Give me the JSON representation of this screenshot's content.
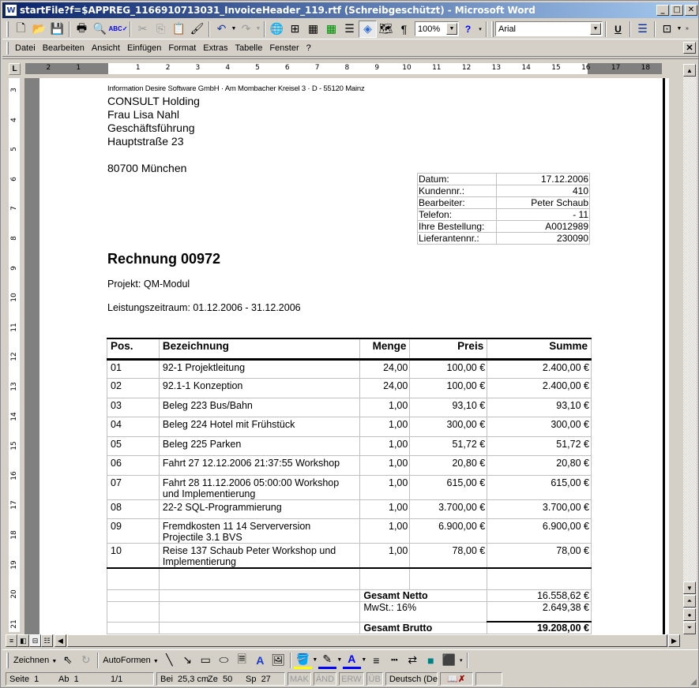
{
  "window": {
    "title": "startFile?f=$APPREG_1166910713031_InvoiceHeader_119.rtf (Schreibgeschützt) - Microsoft Word",
    "app_icon": "word-icon",
    "controls": [
      "minimize",
      "maximize",
      "close"
    ]
  },
  "standard_toolbar": {
    "zoom": "100%",
    "font": "Arial",
    "buttons": [
      "new-document",
      "open",
      "save",
      "print",
      "print-preview",
      "spelling",
      "cut",
      "copy",
      "paste",
      "format-painter",
      "undo",
      "redo",
      "hyperlink",
      "tables-borders",
      "insert-table",
      "insert-excel",
      "columns",
      "drawing",
      "document-map",
      "show-formatting",
      "help",
      "underline",
      "bullets",
      "borders"
    ]
  },
  "menu": {
    "items": [
      {
        "label": "Datei",
        "accel": "D"
      },
      {
        "label": "Bearbeiten",
        "accel": "B"
      },
      {
        "label": "Ansicht",
        "accel": "A"
      },
      {
        "label": "Einfügen",
        "accel": "E"
      },
      {
        "label": "Format",
        "accel": "t"
      },
      {
        "label": "Extras",
        "accel": "x"
      },
      {
        "label": "Tabelle",
        "accel": "l"
      },
      {
        "label": "Fenster",
        "accel": "F"
      },
      {
        "label": "?",
        "accel": "?"
      }
    ]
  },
  "ruler": {
    "horizontal_labels": [
      "2",
      "1",
      "1",
      "2",
      "3",
      "4",
      "5",
      "6",
      "7",
      "8",
      "9",
      "10",
      "11",
      "12",
      "13",
      "14",
      "15",
      "16",
      "17",
      "18"
    ],
    "vertical_labels": [
      "3",
      "4",
      "5",
      "6",
      "7",
      "8",
      "9",
      "10",
      "11",
      "12",
      "13",
      "14",
      "15",
      "16",
      "17",
      "18",
      "19",
      "20",
      "21"
    ]
  },
  "document": {
    "sender_line": "Information Desire Software GmbH · Am Mombacher Kreisel 3 · D - 55120 Mainz",
    "recipient": [
      "CONSULT Holding",
      "Frau Lisa Nahl",
      "Geschäftsführung",
      "Hauptstraße 23"
    ],
    "city": "80700 München",
    "info": [
      {
        "label": "Datum:",
        "value": "17.12.2006"
      },
      {
        "label": "Kundennr.:",
        "value": "410"
      },
      {
        "label": "Bearbeiter:",
        "value": "Peter Schaub"
      },
      {
        "label": "Telefon:",
        "value": "- 11"
      },
      {
        "label": "Ihre Bestellung:",
        "value": "A0012989"
      },
      {
        "label": "Lieferantennr.:",
        "value": "230090"
      }
    ],
    "heading": "Rechnung 00972",
    "project": "Projekt: QM-Modul",
    "period": "Leistungszeitraum: 01.12.2006 - 31.12.2006",
    "table": {
      "headers": [
        "Pos.",
        "Bezeichnung",
        "Menge",
        "Preis",
        "Summe"
      ],
      "rows": [
        {
          "pos": "01",
          "desc": "92-1 Projektleitung",
          "desc2": "",
          "qty": "24,00",
          "price": "100,00 €",
          "sum": "2.400,00 €"
        },
        {
          "pos": "02",
          "desc": "92.1-1 Konzeption",
          "desc2": "",
          "qty": "24,00",
          "price": "100,00 €",
          "sum": "2.400,00 €"
        },
        {
          "pos": "03",
          "desc": "Beleg 223 Bus/Bahn",
          "desc2": "",
          "qty": "1,00",
          "price": "93,10 €",
          "sum": "93,10 €"
        },
        {
          "pos": "04",
          "desc": "Beleg 224 Hotel mit Frühstück",
          "desc2": "",
          "qty": "1,00",
          "price": "300,00 €",
          "sum": "300,00 €"
        },
        {
          "pos": "05",
          "desc": "Beleg 225 Parken",
          "desc2": "",
          "qty": "1,00",
          "price": "51,72 €",
          "sum": "51,72 €"
        },
        {
          "pos": "06",
          "desc": "Fahrt 27 12.12.2006 21:37:55 Workshop",
          "desc2": "",
          "qty": "1,00",
          "price": "20,80 €",
          "sum": "20,80 €"
        },
        {
          "pos": "07",
          "desc": "Fahrt 28 11.12.2006 05:00:00 Workshop",
          "desc2": "und Implementierung",
          "qty": "1,00",
          "price": "615,00 €",
          "sum": "615,00 €"
        },
        {
          "pos": "08",
          "desc": "22-2 SQL-Programmierung",
          "desc2": "",
          "qty": "1,00",
          "price": "3.700,00 €",
          "sum": "3.700,00 €"
        },
        {
          "pos": "09",
          "desc": "Fremdkosten 11 14 Serverversion",
          "desc2": "Projectile 3.1 BVS",
          "qty": "1,00",
          "price": "6.900,00 €",
          "sum": "6.900,00 €"
        },
        {
          "pos": "10",
          "desc": "Reise 137 Schaub Peter Workshop und",
          "desc2": "Implementierung",
          "qty": "1,00",
          "price": "78,00 €",
          "sum": "78,00 €"
        }
      ],
      "totals": {
        "net_label": "Gesamt Netto",
        "net_value": "16.558,62 €",
        "vat_label": "MwSt.: 16%",
        "vat_value": "2.649,38 €",
        "gross_label": "Gesamt Brutto",
        "gross_value": "19.208,00 €"
      }
    }
  },
  "drawing_toolbar": {
    "draw_label": "Zeichnen",
    "autoshapes_label": "AutoFormen",
    "fill_color": "#ffff00",
    "line_color": "#0000ff",
    "font_color": "#0000ff"
  },
  "status": {
    "page": "Seite  1",
    "section": "Ab  1",
    "pages": "1/1",
    "position": "Bei  25,3 cm",
    "line": "Ze  50",
    "column": "Sp  27",
    "rec": "MAK",
    "trk": "ÄND",
    "ext": "ERW",
    "ovr": "ÜB",
    "language": "Deutsch (De"
  }
}
